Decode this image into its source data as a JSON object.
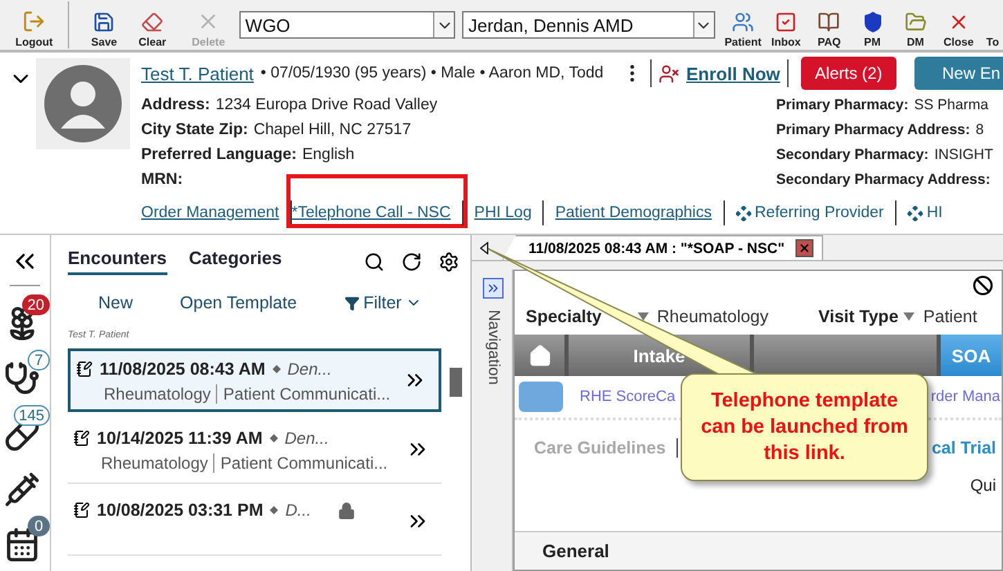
{
  "toolbar": {
    "left_buttons": [
      {
        "label": "Logout",
        "kind": "door",
        "disabled": false
      },
      {
        "label": "Save",
        "kind": "disk",
        "disabled": false
      },
      {
        "label": "Clear",
        "kind": "eraser",
        "disabled": false
      },
      {
        "label": "Delete",
        "kind": "cross",
        "disabled": true
      }
    ],
    "selects": [
      {
        "value": "WGO"
      },
      {
        "value": "Jerdan, Dennis AMD"
      }
    ],
    "right_buttons": [
      {
        "label": "Patient",
        "kind": "patient",
        "disabled": false
      },
      {
        "label": "Inbox",
        "kind": "inbox",
        "disabled": false
      },
      {
        "label": "PAQ",
        "kind": "book",
        "disabled": false
      },
      {
        "label": "PM",
        "kind": "shield",
        "disabled": false
      },
      {
        "label": "DM",
        "kind": "folder",
        "disabled": false
      },
      {
        "label": "Close",
        "kind": "close",
        "disabled": false
      },
      {
        "label": "To",
        "kind": "none",
        "disabled": false
      }
    ]
  },
  "patient": {
    "name": "Test T. Patient",
    "summary": "• 07/05/1930 (95 years) • Male • Aaron MD, Todd",
    "enroll": "Enroll Now",
    "alerts": "Alerts (2)",
    "new_button": "New En",
    "details_left": [
      {
        "label": "Address:",
        "value": "1234 Europa Drive Road Valley"
      },
      {
        "label": "City State Zip:",
        "value": "Chapel Hill, NC 27517"
      },
      {
        "label": "Preferred Language:",
        "value": "English"
      },
      {
        "label": "MRN:"
      }
    ],
    "details_right": [
      {
        "label": "Primary Pharmacy:",
        "value": "SS Pharma"
      },
      {
        "label": "Primary Pharmacy Address:",
        "value": "8"
      },
      {
        "label": "Secondary Pharmacy:",
        "value": "INSIGHT"
      },
      {
        "label": "Secondary Pharmacy Address:"
      }
    ],
    "links": [
      {
        "label": "Order Management",
        "kind": "link",
        "highlighted": false
      },
      {
        "label": "*Telephone Call - NSC",
        "kind": "link",
        "highlighted": true
      },
      {
        "label": "PHI Log",
        "kind": "link",
        "highlighted": false
      },
      {
        "label": "Patient Demographics",
        "kind": "link",
        "highlighted": false
      },
      {
        "label": "Referring Provider",
        "kind": "diamond",
        "highlighted": false
      },
      {
        "label": "HI",
        "kind": "diamond",
        "highlighted": false
      }
    ]
  },
  "sidebar": [
    {
      "kind": "flower",
      "count": "20",
      "color": "#c3202b"
    },
    {
      "kind": "stethoscope",
      "count": "7",
      "color": "#ffffff"
    },
    {
      "kind": "pill",
      "count": "145",
      "color": "#ffffff"
    },
    {
      "kind": "syringe"
    },
    {
      "kind": "calendar",
      "count": "0",
      "color": "#5b7384"
    }
  ],
  "encounters": {
    "tabs": [
      {
        "label": "Encounters",
        "selected": true
      },
      {
        "label": "Categories",
        "selected": false
      }
    ],
    "actions": [
      "New",
      "Open Template",
      "Filter"
    ],
    "patient_label": "Test T. Patient",
    "rows": [
      {
        "date": "11/08/2025 08:43 AM",
        "provider": "Den...",
        "specialty": "Rheumatology",
        "type": "Patient Communicati...",
        "selected": true,
        "locked": false
      },
      {
        "date": "10/14/2025 11:39 AM",
        "provider": "Den...",
        "specialty": "Rheumatology",
        "type": "Patient Communicati...",
        "selected": false,
        "locked": false
      },
      {
        "date": "10/08/2025 03:31 PM",
        "provider": "D...",
        "selected": false,
        "locked": true
      }
    ]
  },
  "document": {
    "tab": "11/08/2025 08:43 AM : \"*SOAP - NSC\"",
    "nav_label": "Navigation",
    "specialty_label": "Specialty",
    "specialty_value": "Rheumatology",
    "visit_type_label": "Visit Type",
    "visit_type_value": "Patient",
    "section_tabs": [
      {
        "kind": "home",
        "selected": false
      },
      {
        "kind": "text",
        "label": "Intake",
        "selected": false
      },
      {
        "kind": "blank",
        "selected": false
      },
      {
        "kind": "text",
        "label": "SOA",
        "selected": true
      }
    ],
    "links": [
      "RHE ScoreCa",
      "rder Mana"
    ],
    "care_guidelines": "Care Guidelines",
    "trial_link": "cal Trial",
    "quick": "Qui",
    "section": "General"
  },
  "annotation": {
    "text": "Telephone template can be launched from this link."
  }
}
